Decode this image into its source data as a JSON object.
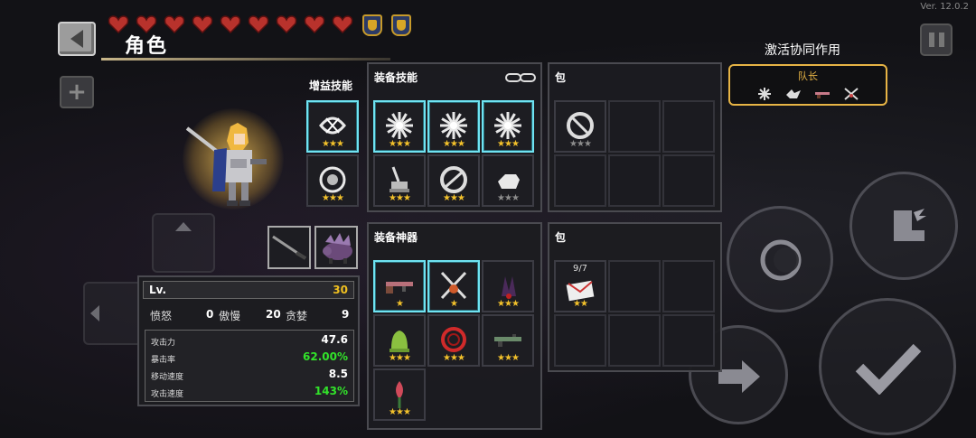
{
  "header": {
    "title": "角色",
    "version": "Ver. 12.0.2",
    "hearts_count": 9,
    "shields_count": 2
  },
  "synergy": {
    "title": "激活协同作用",
    "name": "队长",
    "icons": [
      "burst-icon",
      "wing-icon",
      "gun-icon",
      "crossed-swords-icon"
    ]
  },
  "buff": {
    "label": "增益技能",
    "slots": [
      {
        "icon": "whirl-icon",
        "stars": "★★★",
        "highlight": true
      },
      {
        "icon": "orb-icon",
        "stars": "★★★",
        "highlight": false
      }
    ]
  },
  "equip_skills": {
    "title": "装备技能",
    "slots": [
      {
        "icon": "burst-icon",
        "stars": "★★★",
        "highlight": true
      },
      {
        "icon": "burst-icon",
        "stars": "★★★",
        "highlight": true
      },
      {
        "icon": "burst-icon",
        "stars": "★★★",
        "highlight": true
      },
      {
        "icon": "sword-stand-icon",
        "stars": "★★★",
        "highlight": false
      },
      {
        "icon": "ring-icon",
        "stars": "★★★",
        "highlight": false
      },
      {
        "icon": "glove-icon",
        "stars": "★★★",
        "highlight": false,
        "grey": true
      }
    ]
  },
  "skill_bag": {
    "title": "包",
    "slots": [
      {
        "icon": "no-sign-icon",
        "stars": "★★★",
        "grey": true
      }
    ]
  },
  "equip_artifacts": {
    "title": "装备神器",
    "slots": [
      {
        "icon": "rifle-icon",
        "stars": "★",
        "highlight": true
      },
      {
        "icon": "crossed-blades-icon",
        "stars": "★",
        "highlight": true
      },
      {
        "icon": "claw-icon",
        "stars": "★★★",
        "highlight": false
      },
      {
        "icon": "bell-icon",
        "stars": "★★★",
        "highlight": false
      },
      {
        "icon": "red-ring-icon",
        "stars": "★★★",
        "highlight": false
      },
      {
        "icon": "gun-icon",
        "stars": "★★★",
        "highlight": false
      },
      {
        "icon": "flower-icon",
        "stars": "★★★",
        "highlight": false
      }
    ]
  },
  "artifact_bag": {
    "title": "包",
    "slots": [
      {
        "icon": "letter-icon",
        "stars": "★★",
        "count": "9/7"
      }
    ]
  },
  "stats": {
    "lv_label": "Lv.",
    "lv_value": "30",
    "wrath_label": "愤怒",
    "wrath_value": "0",
    "pride_label": "傲慢",
    "pride_value": "20",
    "greed_label": "贪婪",
    "greed_value": "9",
    "rows": [
      {
        "label": "攻击力",
        "value": "47.6",
        "green": false
      },
      {
        "label": "暴击率",
        "value": "62.00%",
        "green": true
      },
      {
        "label": "移动速度",
        "value": "8.5",
        "green": false
      },
      {
        "label": "攻击速度",
        "value": "143%",
        "green": true
      }
    ]
  },
  "colors": {
    "accent_gold": "#e7b445",
    "highlight_cyan": "#6fe3f2",
    "stat_green": "#32e22a",
    "level_yellow": "#f0c020"
  }
}
